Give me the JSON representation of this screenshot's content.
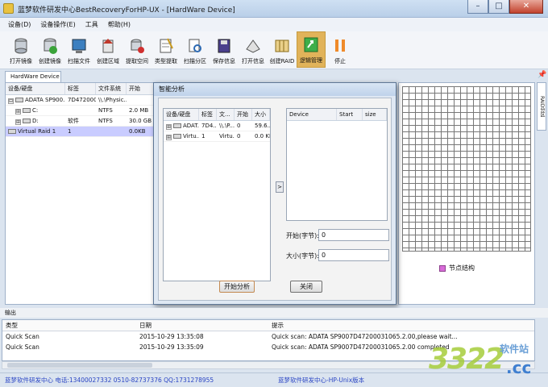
{
  "window": {
    "title": "蓝梦软件研发中心BestRecoveryForHP-UX - [HardWare Device]",
    "minimize_label": "–",
    "maximize_label": "□",
    "close_label": "✕"
  },
  "menu": [
    "设备(D)",
    "设备操作(E)",
    "工具",
    "帮助(H)"
  ],
  "toolbar": [
    {
      "label": "打开镜像",
      "icon": "disk-stack-icon"
    },
    {
      "label": "创建镜像",
      "icon": "create-image-icon"
    },
    {
      "label": "扫描文件",
      "icon": "scan-file-icon"
    },
    {
      "label": "创建区域",
      "icon": "create-region-icon"
    },
    {
      "label": "提取空间",
      "icon": "extract-space-icon"
    },
    {
      "label": "类型提取",
      "icon": "type-extract-icon"
    },
    {
      "label": "扫描分区",
      "icon": "scan-partition-icon"
    },
    {
      "label": "保存信息",
      "icon": "save-icon"
    },
    {
      "label": "打开信息",
      "icon": "open-info-icon"
    },
    {
      "label": "创建RAID",
      "icon": "create-raid-icon"
    },
    {
      "label": "逻辑管理",
      "icon": "logic-manage-icon"
    },
    {
      "label": "停止",
      "icon": "pause-icon"
    }
  ],
  "left_panel": {
    "tab": "HardWare Device",
    "columns": [
      "设备/硬盘",
      "标签",
      "文件系统",
      "开始"
    ],
    "rows": [
      {
        "expander": "⊟",
        "name": "ADATA SP900...",
        "label": "7D472000...",
        "fs": "\\\\.\\Physic...",
        "start": ""
      },
      {
        "expander": "⊞",
        "name": "C:",
        "label": "",
        "fs": "NTFS",
        "start": "2.0 MB"
      },
      {
        "expander": "⊞",
        "name": "D:",
        "label": "软件",
        "fs": "NTFS",
        "start": "30.0 GB"
      },
      {
        "expander": "",
        "name": "Virtual Raid 1",
        "label": "1",
        "fs": "",
        "start": "0.0KB"
      }
    ]
  },
  "dialog": {
    "title": "智能分析",
    "left_table": {
      "columns": [
        "设备/硬盘",
        "标签",
        "文...",
        "开始",
        "大小"
      ],
      "rows": [
        {
          "expander": "⊞",
          "name": "ADAT...",
          "label": "7D4...",
          "fs": "\\\\.\\P...",
          "start": "0",
          "size": "59.6..."
        },
        {
          "expander": "⊞",
          "name": "Virtu...",
          "label": "1",
          "fs": "Virtu...",
          "start": "0",
          "size": "0.0 KB"
        }
      ]
    },
    "right_table": {
      "columns": [
        "Device",
        "Start",
        "size"
      ]
    },
    "arrow": ">",
    "start_label": "开始(字节):",
    "start_value": "0",
    "size_label": "大小(字节):",
    "size_value": "0",
    "analyze_button": "开始分析",
    "close_button": "关闭"
  },
  "grid_panel": {
    "legend": "节点结构",
    "legend_color": "#d86bd8",
    "side_tab": "RAID分区"
  },
  "output": {
    "title": "输出",
    "columns": [
      "类型",
      "日期",
      "提示"
    ],
    "rows": [
      {
        "type": "Quick Scan",
        "date": "2015-10-29 13:35:08",
        "msg": "Quick scan: ADATA SP9007D47200031065.2.00,please wait..."
      },
      {
        "type": "Quick Scan",
        "date": "2015-10-29 13:35:09",
        "msg": "Quick scan: ADATA SP9007D47200031065.2.00 completed"
      }
    ]
  },
  "status": {
    "left": "蓝梦软件研发中心 电话:13400027332 0510-82737376 QQ:1731278955",
    "right": "蓝梦软件研发中心-HP-Unix版本"
  },
  "watermark": {
    "main": "3322",
    "sub": "软件站",
    "suffix": ".cc"
  }
}
